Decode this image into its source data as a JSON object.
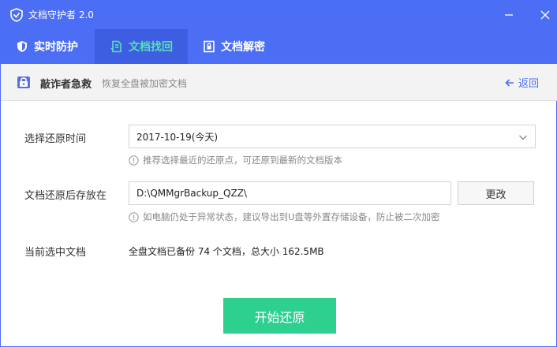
{
  "window": {
    "title": "文档守护者 2.0",
    "accent_color": "#4c6ef5",
    "active_tab_text_color": "#57e0b8",
    "primary_button_color": "#2ed08f"
  },
  "tabs": [
    {
      "label": "实时防护",
      "icon": "shield-icon",
      "active": false
    },
    {
      "label": "文档找回",
      "icon": "document-recover-icon",
      "active": true
    },
    {
      "label": "文档解密",
      "icon": "document-lock-icon",
      "active": false
    }
  ],
  "subheader": {
    "title": "敲诈者急救",
    "description": "恢复全盘被加密文档",
    "back_label": "返回"
  },
  "form": {
    "restore_time_label": "选择还原时间",
    "restore_time_value": "2017-10-19(今天)",
    "restore_time_hint": "推荐选择最近的还原点，可还原到最新的文档版本",
    "save_path_label": "文档还原后存放在",
    "save_path_value": "D:\\QMMgrBackup_QZZ\\",
    "change_label": "更改",
    "save_path_hint": "如电脑仍处于异常状态，建议导出到U盘等外置存储设备，防止被二次加密",
    "current_label": "当前选中文档",
    "current_value": "全盘文档已备份 74 个文档，总大小 162.5MB"
  },
  "start_button_label": "开始还原"
}
